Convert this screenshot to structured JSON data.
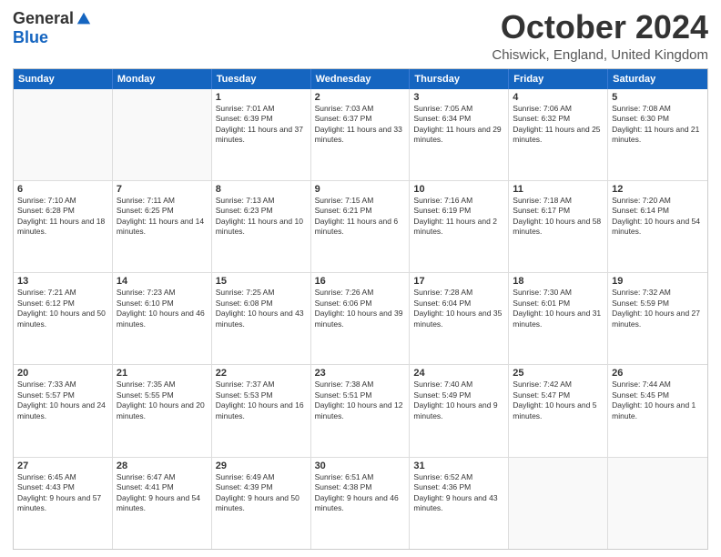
{
  "header": {
    "logo": {
      "general": "General",
      "blue": "Blue"
    },
    "title": "October 2024",
    "subtitle": "Chiswick, England, United Kingdom"
  },
  "weekdays": [
    "Sunday",
    "Monday",
    "Tuesday",
    "Wednesday",
    "Thursday",
    "Friday",
    "Saturday"
  ],
  "weeks": [
    [
      {
        "day": "",
        "sunrise": "",
        "sunset": "",
        "daylight": ""
      },
      {
        "day": "",
        "sunrise": "",
        "sunset": "",
        "daylight": ""
      },
      {
        "day": "1",
        "sunrise": "Sunrise: 7:01 AM",
        "sunset": "Sunset: 6:39 PM",
        "daylight": "Daylight: 11 hours and 37 minutes."
      },
      {
        "day": "2",
        "sunrise": "Sunrise: 7:03 AM",
        "sunset": "Sunset: 6:37 PM",
        "daylight": "Daylight: 11 hours and 33 minutes."
      },
      {
        "day": "3",
        "sunrise": "Sunrise: 7:05 AM",
        "sunset": "Sunset: 6:34 PM",
        "daylight": "Daylight: 11 hours and 29 minutes."
      },
      {
        "day": "4",
        "sunrise": "Sunrise: 7:06 AM",
        "sunset": "Sunset: 6:32 PM",
        "daylight": "Daylight: 11 hours and 25 minutes."
      },
      {
        "day": "5",
        "sunrise": "Sunrise: 7:08 AM",
        "sunset": "Sunset: 6:30 PM",
        "daylight": "Daylight: 11 hours and 21 minutes."
      }
    ],
    [
      {
        "day": "6",
        "sunrise": "Sunrise: 7:10 AM",
        "sunset": "Sunset: 6:28 PM",
        "daylight": "Daylight: 11 hours and 18 minutes."
      },
      {
        "day": "7",
        "sunrise": "Sunrise: 7:11 AM",
        "sunset": "Sunset: 6:25 PM",
        "daylight": "Daylight: 11 hours and 14 minutes."
      },
      {
        "day": "8",
        "sunrise": "Sunrise: 7:13 AM",
        "sunset": "Sunset: 6:23 PM",
        "daylight": "Daylight: 11 hours and 10 minutes."
      },
      {
        "day": "9",
        "sunrise": "Sunrise: 7:15 AM",
        "sunset": "Sunset: 6:21 PM",
        "daylight": "Daylight: 11 hours and 6 minutes."
      },
      {
        "day": "10",
        "sunrise": "Sunrise: 7:16 AM",
        "sunset": "Sunset: 6:19 PM",
        "daylight": "Daylight: 11 hours and 2 minutes."
      },
      {
        "day": "11",
        "sunrise": "Sunrise: 7:18 AM",
        "sunset": "Sunset: 6:17 PM",
        "daylight": "Daylight: 10 hours and 58 minutes."
      },
      {
        "day": "12",
        "sunrise": "Sunrise: 7:20 AM",
        "sunset": "Sunset: 6:14 PM",
        "daylight": "Daylight: 10 hours and 54 minutes."
      }
    ],
    [
      {
        "day": "13",
        "sunrise": "Sunrise: 7:21 AM",
        "sunset": "Sunset: 6:12 PM",
        "daylight": "Daylight: 10 hours and 50 minutes."
      },
      {
        "day": "14",
        "sunrise": "Sunrise: 7:23 AM",
        "sunset": "Sunset: 6:10 PM",
        "daylight": "Daylight: 10 hours and 46 minutes."
      },
      {
        "day": "15",
        "sunrise": "Sunrise: 7:25 AM",
        "sunset": "Sunset: 6:08 PM",
        "daylight": "Daylight: 10 hours and 43 minutes."
      },
      {
        "day": "16",
        "sunrise": "Sunrise: 7:26 AM",
        "sunset": "Sunset: 6:06 PM",
        "daylight": "Daylight: 10 hours and 39 minutes."
      },
      {
        "day": "17",
        "sunrise": "Sunrise: 7:28 AM",
        "sunset": "Sunset: 6:04 PM",
        "daylight": "Daylight: 10 hours and 35 minutes."
      },
      {
        "day": "18",
        "sunrise": "Sunrise: 7:30 AM",
        "sunset": "Sunset: 6:01 PM",
        "daylight": "Daylight: 10 hours and 31 minutes."
      },
      {
        "day": "19",
        "sunrise": "Sunrise: 7:32 AM",
        "sunset": "Sunset: 5:59 PM",
        "daylight": "Daylight: 10 hours and 27 minutes."
      }
    ],
    [
      {
        "day": "20",
        "sunrise": "Sunrise: 7:33 AM",
        "sunset": "Sunset: 5:57 PM",
        "daylight": "Daylight: 10 hours and 24 minutes."
      },
      {
        "day": "21",
        "sunrise": "Sunrise: 7:35 AM",
        "sunset": "Sunset: 5:55 PM",
        "daylight": "Daylight: 10 hours and 20 minutes."
      },
      {
        "day": "22",
        "sunrise": "Sunrise: 7:37 AM",
        "sunset": "Sunset: 5:53 PM",
        "daylight": "Daylight: 10 hours and 16 minutes."
      },
      {
        "day": "23",
        "sunrise": "Sunrise: 7:38 AM",
        "sunset": "Sunset: 5:51 PM",
        "daylight": "Daylight: 10 hours and 12 minutes."
      },
      {
        "day": "24",
        "sunrise": "Sunrise: 7:40 AM",
        "sunset": "Sunset: 5:49 PM",
        "daylight": "Daylight: 10 hours and 9 minutes."
      },
      {
        "day": "25",
        "sunrise": "Sunrise: 7:42 AM",
        "sunset": "Sunset: 5:47 PM",
        "daylight": "Daylight: 10 hours and 5 minutes."
      },
      {
        "day": "26",
        "sunrise": "Sunrise: 7:44 AM",
        "sunset": "Sunset: 5:45 PM",
        "daylight": "Daylight: 10 hours and 1 minute."
      }
    ],
    [
      {
        "day": "27",
        "sunrise": "Sunrise: 6:45 AM",
        "sunset": "Sunset: 4:43 PM",
        "daylight": "Daylight: 9 hours and 57 minutes."
      },
      {
        "day": "28",
        "sunrise": "Sunrise: 6:47 AM",
        "sunset": "Sunset: 4:41 PM",
        "daylight": "Daylight: 9 hours and 54 minutes."
      },
      {
        "day": "29",
        "sunrise": "Sunrise: 6:49 AM",
        "sunset": "Sunset: 4:39 PM",
        "daylight": "Daylight: 9 hours and 50 minutes."
      },
      {
        "day": "30",
        "sunrise": "Sunrise: 6:51 AM",
        "sunset": "Sunset: 4:38 PM",
        "daylight": "Daylight: 9 hours and 46 minutes."
      },
      {
        "day": "31",
        "sunrise": "Sunrise: 6:52 AM",
        "sunset": "Sunset: 4:36 PM",
        "daylight": "Daylight: 9 hours and 43 minutes."
      },
      {
        "day": "",
        "sunrise": "",
        "sunset": "",
        "daylight": ""
      },
      {
        "day": "",
        "sunrise": "",
        "sunset": "",
        "daylight": ""
      }
    ]
  ]
}
